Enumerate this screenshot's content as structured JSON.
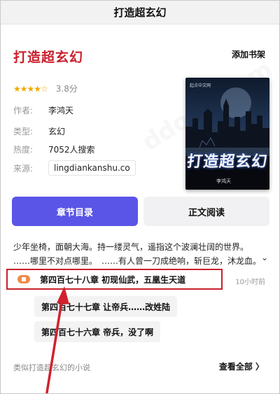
{
  "navbar": {
    "title": "打造超玄幻"
  },
  "book": {
    "title": "打造超玄幻",
    "add_shelf": "添加书架",
    "stars": "★★★★☆",
    "rating": "3.8分",
    "meta": [
      {
        "label": "作者:",
        "value": "李鸿天"
      },
      {
        "label": "类型:",
        "value": "玄幻"
      },
      {
        "label": "热度:",
        "value": "7052人搜索"
      },
      {
        "label": "来源:",
        "value": "lingdiankanshu.co"
      }
    ]
  },
  "cover": {
    "title": "打造超玄幻",
    "author": "李鸿天",
    "brand": "起点中文网"
  },
  "buttons": {
    "toc": "章节目录",
    "read": "正文阅读"
  },
  "synopsis": {
    "lines": [
      "少年坐椅，面朝大海。持一缕灵气，遥指这个波澜壮阔的世界。",
      "……哪里不对点哪里。　……有人曾一刀成绝响，斩巨龙，沐龙血。"
    ],
    "expand_icon": "⌄"
  },
  "chapters": {
    "latest": "第四百七十八章  初现仙武，五凰生天道",
    "latest_time": "10小时前",
    "others": [
      "第四百七十七章 让帝兵……改姓陆",
      "第四百七十六章 帝兵，没了啊"
    ]
  },
  "footer": {
    "similar": "类似打造超玄幻的小说",
    "view_all": "查看全部 〉"
  },
  "colors": {
    "accent": "#5a55e6",
    "title_red": "#c9202c",
    "star": "#f2a900",
    "arrow": "#d2202e"
  }
}
